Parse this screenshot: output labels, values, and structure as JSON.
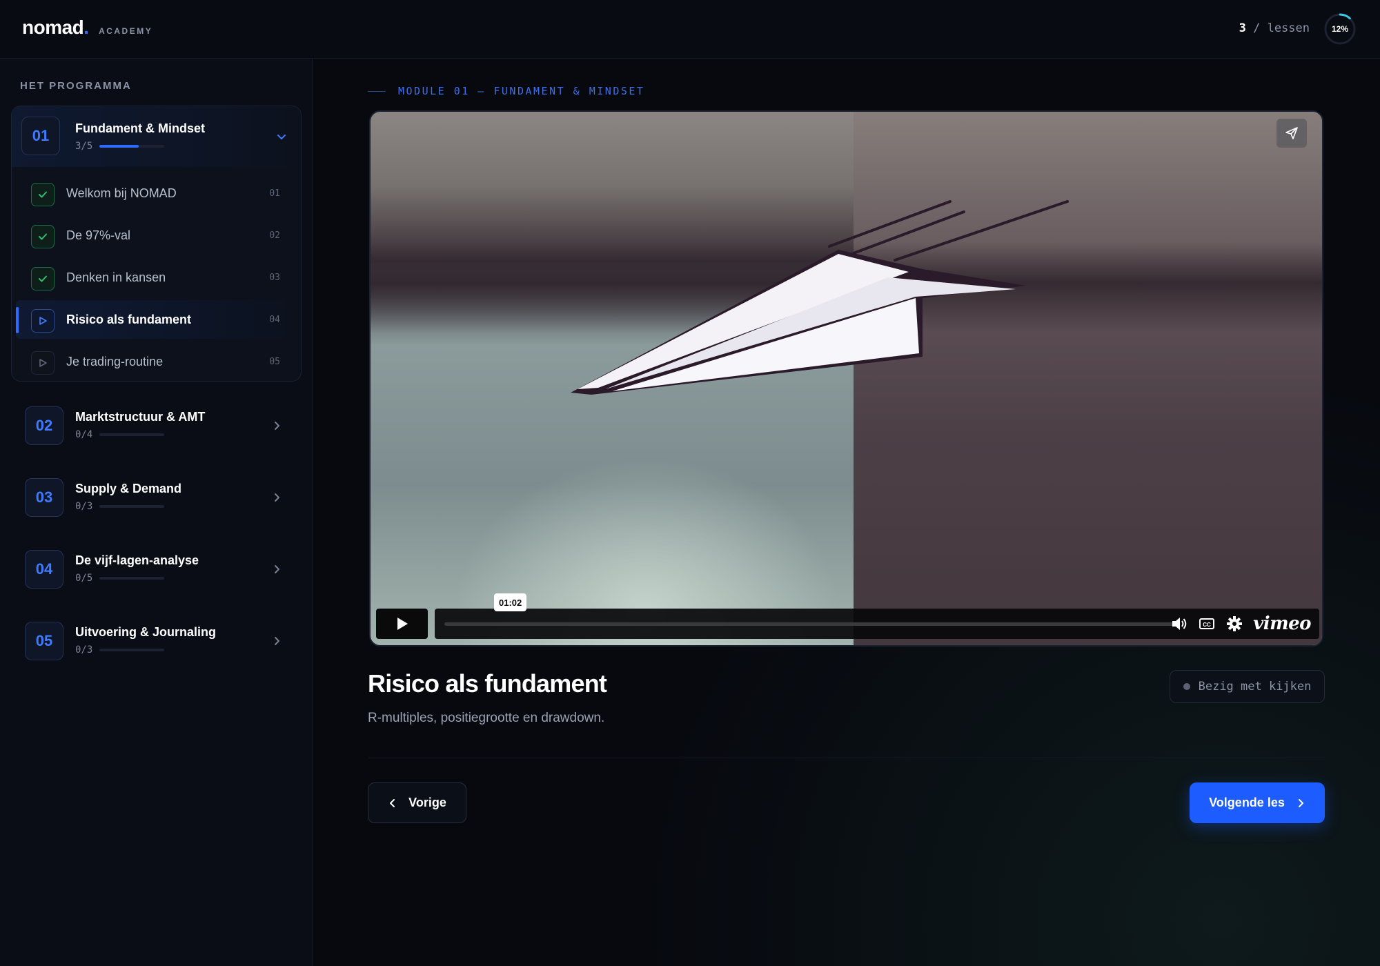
{
  "header": {
    "logo_word": "nomad",
    "logo_dot": ".",
    "logo_sub": "ACADEMY",
    "lesson_count_num": "3",
    "lesson_count_text": " / lessen",
    "progress_pct": "12%",
    "progress_fraction": 0.12
  },
  "sidebar": {
    "heading": "HET PROGRAMMA",
    "open_module": {
      "number": "01",
      "title": "Fundament & Mindset",
      "progress_text": "3/5",
      "progress_fraction": 0.6,
      "lessons": [
        {
          "label": "Welkom bij NOMAD",
          "num": "01",
          "state": "done"
        },
        {
          "label": "De 97%-val",
          "num": "02",
          "state": "done"
        },
        {
          "label": "Denken in kansen",
          "num": "03",
          "state": "done"
        },
        {
          "label": "Risico als fundament",
          "num": "04",
          "state": "active"
        },
        {
          "label": "Je trading-routine",
          "num": "05",
          "state": "idle"
        }
      ]
    },
    "modules": [
      {
        "number": "02",
        "title": "Marktstructuur & AMT",
        "progress_text": "0/4",
        "progress_fraction": 0
      },
      {
        "number": "03",
        "title": "Supply & Demand",
        "progress_text": "0/3",
        "progress_fraction": 0
      },
      {
        "number": "04",
        "title": "De vijf-lagen-analyse",
        "progress_text": "0/5",
        "progress_fraction": 0
      },
      {
        "number": "05",
        "title": "Uitvoering & Journaling",
        "progress_text": "0/3",
        "progress_fraction": 0
      }
    ]
  },
  "main": {
    "breadcrumb": "MODULE 01 — FUNDAMENT & MINDSET",
    "video": {
      "time_tooltip": "01:02",
      "brand": "vimeo",
      "progress_fraction": 0
    },
    "lesson_title": "Risico als fundament",
    "lesson_subtitle": "R-multiples, positiegrootte en drawdown.",
    "status_label": "Bezig met kijken",
    "prev_label": "Vorige",
    "next_label": "Volgende les"
  },
  "colors": {
    "accent": "#2f6bff",
    "success": "#2fbf71",
    "background": "#07090f"
  }
}
